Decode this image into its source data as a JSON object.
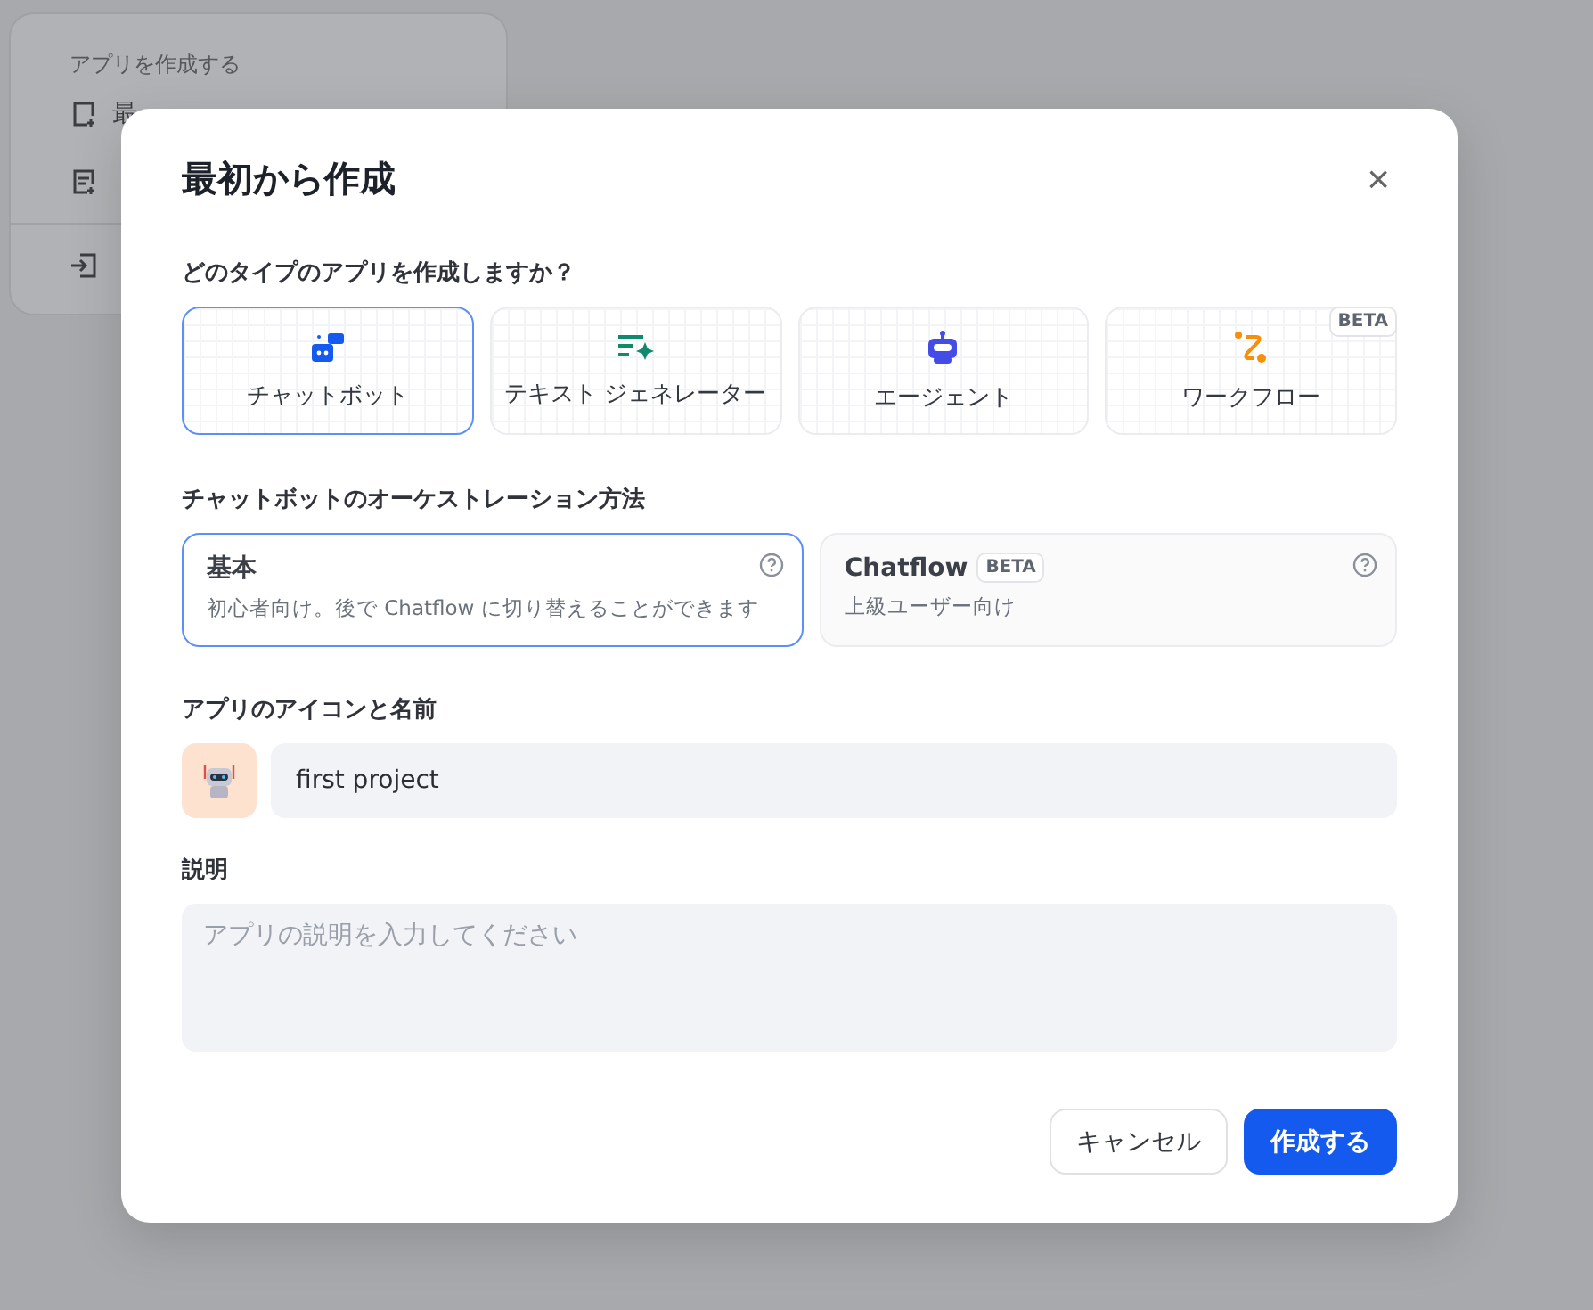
{
  "background_menu": {
    "title": "アプリを作成する",
    "first_item": "最"
  },
  "dialog": {
    "title": "最初から作成",
    "close": "×",
    "type_question": "どのタイプのアプリを作成しますか？",
    "app_types": [
      {
        "kind": "chatbot",
        "label": "チャットボット",
        "selected": true
      },
      {
        "kind": "text",
        "label": "テキスト ジェネレーター",
        "selected": false
      },
      {
        "kind": "agent",
        "label": "エージェント",
        "selected": false
      },
      {
        "kind": "workflow",
        "label": "ワークフロー",
        "selected": false,
        "badge": "BETA"
      }
    ],
    "orchestration_label": "チャットボットのオーケストレーション方法",
    "orchestration": [
      {
        "title": "基本",
        "description": "初心者向け。後で Chatflow に切り替えることができます",
        "selected": true
      },
      {
        "title": "Chatflow",
        "badge": "BETA",
        "description": "上級ユーザー向け",
        "selected": false
      }
    ],
    "name_label": "アプリのアイコンと名前",
    "name_value": "first project",
    "description_label": "説明",
    "description_placeholder": "アプリの説明を入力してください",
    "buttons": [
      {
        "kind": "secondary",
        "label": "キャンセル"
      },
      {
        "kind": "primary",
        "label": "作成する"
      }
    ]
  }
}
